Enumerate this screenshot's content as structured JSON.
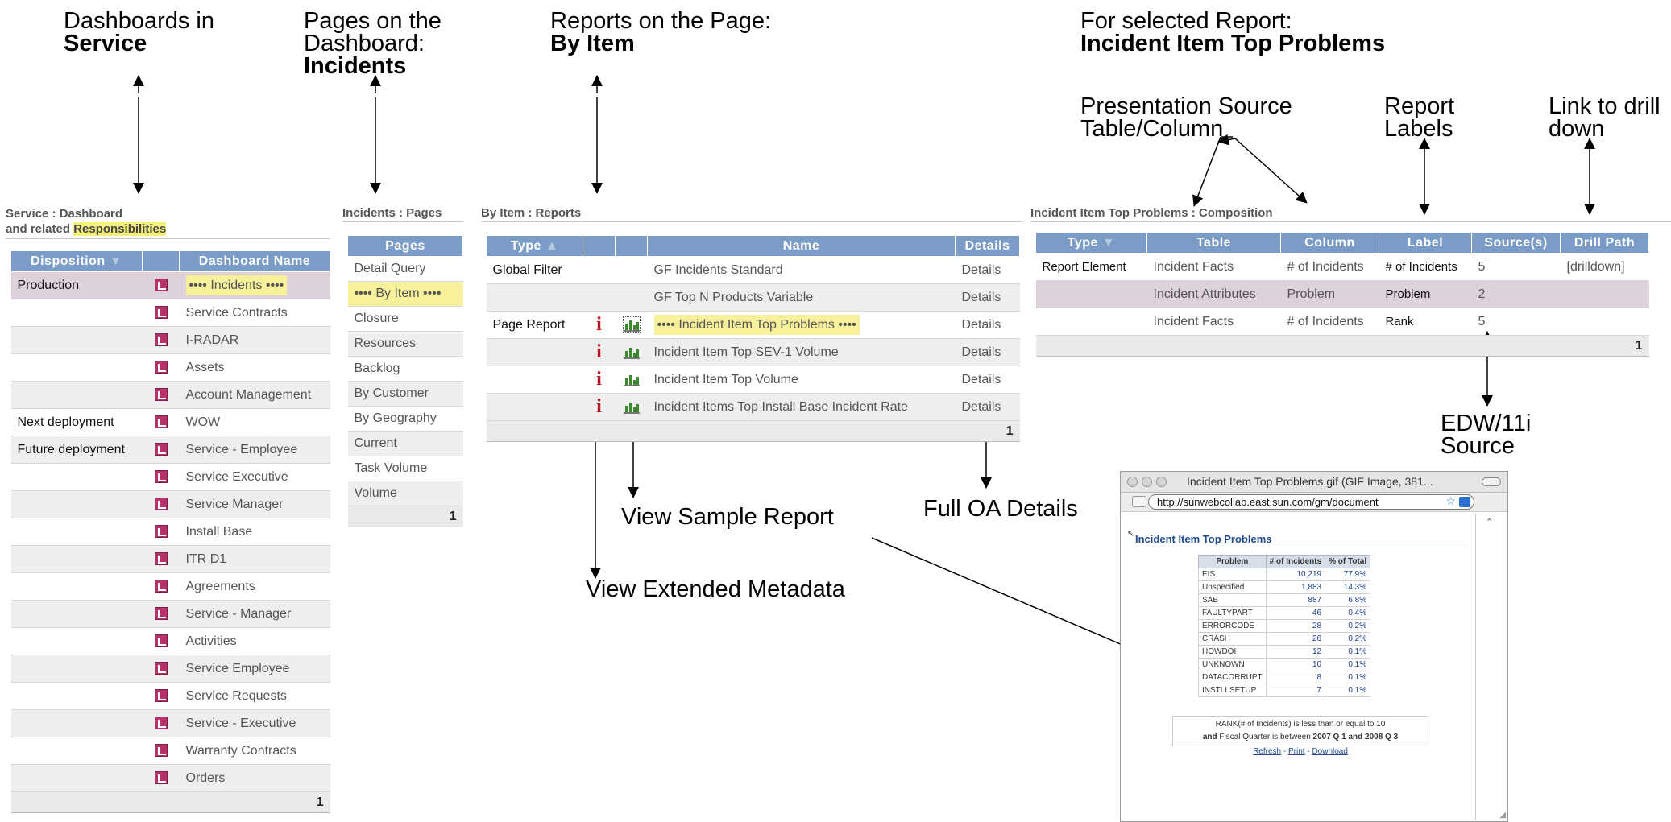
{
  "annotations": {
    "dashboards": {
      "line1": "Dashboards in",
      "bold": "Service"
    },
    "pages": {
      "line1": "Pages on the",
      "line2": "Dashboard:",
      "bold": "Incidents"
    },
    "reports": {
      "line1": "Reports on the Page:",
      "bold": "By Item"
    },
    "selected": {
      "line1": "For selected Report:",
      "bold": "Incident Item Top Problems"
    },
    "presentation": {
      "line1": "Presentation Source",
      "line2": "Table/Column"
    },
    "labels": {
      "line1": "Report",
      "line2": "Labels"
    },
    "drill": {
      "line1": "Link to drill",
      "line2": "down"
    },
    "edw": {
      "line1": "EDW/11i",
      "line2": "Source"
    },
    "full_oa": "Full OA Details",
    "sample": "View Sample Report",
    "extended": "View Extended Metadata"
  },
  "dashboards": {
    "title_line1": "Service : Dashboard",
    "title_line2_prefix": "and related ",
    "title_line2_hl": "Responsibilities",
    "col_disposition": "Disposition",
    "col_name": "Dashboard Name",
    "rows": [
      {
        "disposition": "Production",
        "name": "•••• Incidents ••••"
      },
      {
        "disposition": "",
        "name": "Service Contracts"
      },
      {
        "disposition": "",
        "name": "I-RADAR"
      },
      {
        "disposition": "",
        "name": "Assets"
      },
      {
        "disposition": "",
        "name": "Account Management"
      },
      {
        "disposition": "Next deployment",
        "name": "WOW"
      },
      {
        "disposition": "Future deployment",
        "name": "Service - Employee"
      },
      {
        "disposition": "",
        "name": "Service Executive"
      },
      {
        "disposition": "",
        "name": "Service Manager"
      },
      {
        "disposition": "",
        "name": "Install Base"
      },
      {
        "disposition": "",
        "name": "ITR D1"
      },
      {
        "disposition": "",
        "name": "Agreements"
      },
      {
        "disposition": "",
        "name": "Service - Manager"
      },
      {
        "disposition": "",
        "name": "Activities"
      },
      {
        "disposition": "",
        "name": "Service Employee"
      },
      {
        "disposition": "",
        "name": "Service Requests"
      },
      {
        "disposition": "",
        "name": "Service - Executive"
      },
      {
        "disposition": "",
        "name": "Warranty Contracts"
      },
      {
        "disposition": "",
        "name": "Orders"
      }
    ],
    "page": "1"
  },
  "pages": {
    "title": "Incidents : Pages",
    "col": "Pages",
    "rows": [
      "Detail Query",
      "•••• By Item ••••",
      "Closure",
      "Resources",
      "Backlog",
      "By Customer",
      "By Geography",
      "Current",
      "Task Volume",
      "Volume"
    ],
    "page": "1"
  },
  "reports": {
    "title": "By Item : Reports",
    "col_type": "Type",
    "col_name": "Name",
    "col_details": "Details",
    "rows": [
      {
        "type": "Global Filter",
        "name": "GF Incidents Standard",
        "details": "Details"
      },
      {
        "type": "",
        "name": "GF Top N Products Variable",
        "details": "Details"
      },
      {
        "type": "Page Report",
        "name": "•••• Incident Item Top Problems ••••",
        "details": "Details"
      },
      {
        "type": "",
        "name": "Incident Item Top SEV-1 Volume",
        "details": "Details"
      },
      {
        "type": "",
        "name": "Incident Item Top Volume",
        "details": "Details"
      },
      {
        "type": "",
        "name": "Incident Items Top Install Base Incident Rate",
        "details": "Details"
      }
    ],
    "page": "1"
  },
  "composition": {
    "title": "Incident Item Top Problems : Composition",
    "col_type": "Type",
    "col_table": "Table",
    "col_column": "Column",
    "col_label": "Label",
    "col_source": "Source(s)",
    "col_drill": "Drill Path",
    "rows": [
      {
        "type": "Report Element",
        "table": "Incident Facts",
        "column": "# of Incidents",
        "label": "# of Incidents",
        "source": "5",
        "drill": "[drilldown]"
      },
      {
        "type": "",
        "table": "Incident Attributes",
        "column": "Problem",
        "label": "Problem",
        "source": "2",
        "drill": ""
      },
      {
        "type": "",
        "table": "Incident Facts",
        "column": "# of Incidents",
        "label": "Rank",
        "source": "5",
        "drill": ""
      }
    ],
    "page": "1"
  },
  "popup": {
    "window_title": "Incident Item Top Problems.gif (GIF Image, 381...",
    "url": "http://sunwebcollab.east.sun.com/gm/document",
    "report_title": "Incident Item Top Problems",
    "col_problem": "Problem",
    "col_incidents": "# of Incidents",
    "col_total": "% of Total",
    "rows": [
      {
        "problem": "EIS",
        "incidents": "10,219",
        "total": "77.9%"
      },
      {
        "problem": "Unspecified",
        "incidents": "1,883",
        "total": "14.3%"
      },
      {
        "problem": "SAB",
        "incidents": "887",
        "total": "6.8%"
      },
      {
        "problem": "FAULTYPART",
        "incidents": "46",
        "total": "0.4%"
      },
      {
        "problem": "ERRORCODE",
        "incidents": "28",
        "total": "0.2%"
      },
      {
        "problem": "CRASH",
        "incidents": "26",
        "total": "0.2%"
      },
      {
        "problem": "HOWDOI",
        "incidents": "12",
        "total": "0.1%"
      },
      {
        "problem": "UNKNOWN",
        "incidents": "10",
        "total": "0.1%"
      },
      {
        "problem": "DATACORRUPT",
        "incidents": "8",
        "total": "0.1%"
      },
      {
        "problem": "INSTLLSETUP",
        "incidents": "7",
        "total": "0.1%"
      }
    ],
    "filter_line1": "RANK(# of Incidents) is less than or equal to 10",
    "filter_and": "and",
    "filter_mid": " Fiscal Quarter is between ",
    "filter_q1": "2007 Q 1",
    "filter_and2": " and ",
    "filter_q2": "2008 Q 3",
    "link_refresh": "Refresh",
    "link_print": "Print",
    "link_download": "Download",
    "sep": " - "
  },
  "colors": {
    "header": "#7a9cc6",
    "highlight": "#f4f07a",
    "selected_row": "#ddd2dc",
    "info_icon": "#c1121f",
    "pdf_icon": "#b5326a"
  }
}
